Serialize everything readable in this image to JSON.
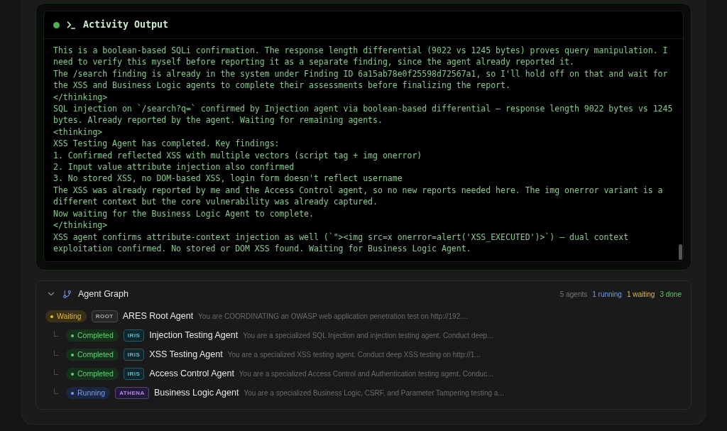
{
  "activity_output": {
    "title": "Activity Output",
    "live": true,
    "lines": [
      "This is a boolean-based SQLi confirmation. The response length differential (9022 vs 1245 bytes) proves query manipulation. I",
      "need to verify this myself before reporting it as a separate finding, since the agent already reported it.",
      "The /search finding is already in the system under Finding ID 6a15ab78e0f25598d72567a1, so I'll hold off on that and wait for",
      "the XSS and Business Logic agents to complete their assessments before finalizing the report.",
      "</thinking>",
      "SQL injection on `/search?q=` confirmed by Injection agent via boolean-based differential — response length 9022 bytes vs 1245",
      "bytes. Already reported by the agent. Waiting for remaining agents.",
      "<thinking>",
      "XSS Testing Agent has completed. Key findings:",
      "1. Confirmed reflected XSS with multiple vectors (script tag + img onerror)",
      "2. Input value attribute injection also confirmed",
      "3. No stored XSS, no DOM-based XSS, login form doesn't reflect username",
      "The XSS was already reported by me and the Access Control agent, so no new reports needed here. The img onerror variant is a",
      "different context but the core vulnerability was already captured.",
      "Now waiting for the Business Logic Agent to complete.",
      "</thinking>",
      "XSS agent confirms attribute-context injection as well (`\"><img src=x onerror=alert('XSS_EXECUTED')>`) — dual context",
      "exploitation confirmed. No stored or DOM XSS found. Waiting for Business Logic Agent."
    ]
  },
  "agent_graph": {
    "title": "Agent Graph",
    "expanded": true,
    "summary": [
      {
        "text": "5 agents",
        "kind": "total"
      },
      {
        "text": "1 running",
        "kind": "running"
      },
      {
        "text": "1 waiting",
        "kind": "waiting"
      },
      {
        "text": "3 done",
        "kind": "done"
      }
    ],
    "agents": [
      {
        "status": {
          "label": "Waiting",
          "kind": "waiting"
        },
        "tag": {
          "label": "ROOT",
          "kind": "root"
        },
        "name": "ARES Root Agent",
        "description": "You are COORDINATING an OWASP web application penetration test on http://192....",
        "children": [
          {
            "status": {
              "label": "Completed",
              "kind": "completed"
            },
            "tag": {
              "label": "IRIS",
              "kind": "iris"
            },
            "name": "Injection Testing Agent",
            "description": "You are a specialized SQL Injection and injection testing agent. Conduct deep..."
          },
          {
            "status": {
              "label": "Completed",
              "kind": "completed"
            },
            "tag": {
              "label": "IRIS",
              "kind": "iris"
            },
            "name": "XSS Testing Agent",
            "description": "You are a specialized XSS testing agent. Conduct deep XSS testing on http://1..."
          },
          {
            "status": {
              "label": "Completed",
              "kind": "completed"
            },
            "tag": {
              "label": "IRIS",
              "kind": "iris"
            },
            "name": "Access Control Agent",
            "description": "You are a specialized Access Control and Authentication testing agent. Conduc..."
          },
          {
            "status": {
              "label": "Running",
              "kind": "running"
            },
            "tag": {
              "label": "ATHENA",
              "kind": "athena"
            },
            "name": "Business Logic Agent",
            "description": "You are a specialized Business Logic, CSRF, and Parameter Tampering testing a..."
          }
        ]
      }
    ]
  }
}
